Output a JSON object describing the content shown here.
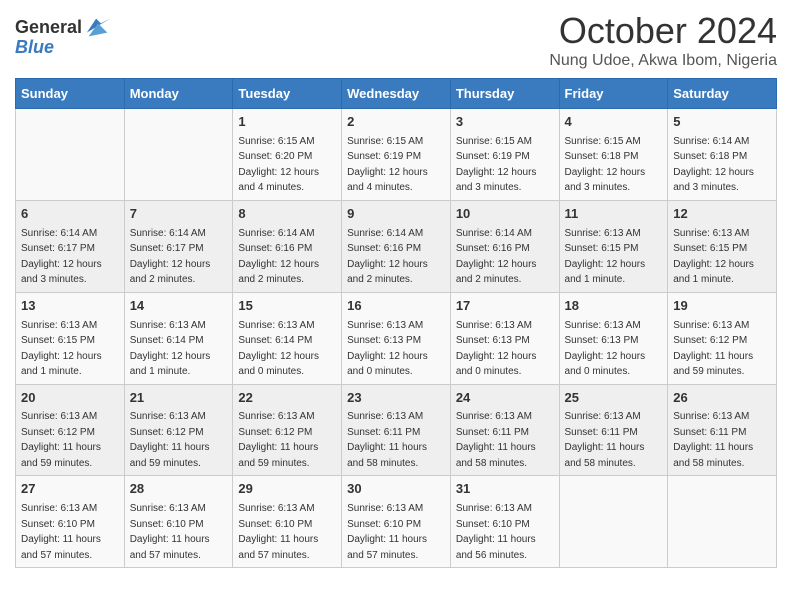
{
  "logo": {
    "line1": "General",
    "line2": "Blue"
  },
  "title": "October 2024",
  "location": "Nung Udoe, Akwa Ibom, Nigeria",
  "days_of_week": [
    "Sunday",
    "Monday",
    "Tuesday",
    "Wednesday",
    "Thursday",
    "Friday",
    "Saturday"
  ],
  "weeks": [
    [
      {
        "day": "",
        "sunrise": "",
        "sunset": "",
        "daylight": ""
      },
      {
        "day": "",
        "sunrise": "",
        "sunset": "",
        "daylight": ""
      },
      {
        "day": "1",
        "sunrise": "Sunrise: 6:15 AM",
        "sunset": "Sunset: 6:20 PM",
        "daylight": "Daylight: 12 hours and 4 minutes."
      },
      {
        "day": "2",
        "sunrise": "Sunrise: 6:15 AM",
        "sunset": "Sunset: 6:19 PM",
        "daylight": "Daylight: 12 hours and 4 minutes."
      },
      {
        "day": "3",
        "sunrise": "Sunrise: 6:15 AM",
        "sunset": "Sunset: 6:19 PM",
        "daylight": "Daylight: 12 hours and 3 minutes."
      },
      {
        "day": "4",
        "sunrise": "Sunrise: 6:15 AM",
        "sunset": "Sunset: 6:18 PM",
        "daylight": "Daylight: 12 hours and 3 minutes."
      },
      {
        "day": "5",
        "sunrise": "Sunrise: 6:14 AM",
        "sunset": "Sunset: 6:18 PM",
        "daylight": "Daylight: 12 hours and 3 minutes."
      }
    ],
    [
      {
        "day": "6",
        "sunrise": "Sunrise: 6:14 AM",
        "sunset": "Sunset: 6:17 PM",
        "daylight": "Daylight: 12 hours and 3 minutes."
      },
      {
        "day": "7",
        "sunrise": "Sunrise: 6:14 AM",
        "sunset": "Sunset: 6:17 PM",
        "daylight": "Daylight: 12 hours and 2 minutes."
      },
      {
        "day": "8",
        "sunrise": "Sunrise: 6:14 AM",
        "sunset": "Sunset: 6:16 PM",
        "daylight": "Daylight: 12 hours and 2 minutes."
      },
      {
        "day": "9",
        "sunrise": "Sunrise: 6:14 AM",
        "sunset": "Sunset: 6:16 PM",
        "daylight": "Daylight: 12 hours and 2 minutes."
      },
      {
        "day": "10",
        "sunrise": "Sunrise: 6:14 AM",
        "sunset": "Sunset: 6:16 PM",
        "daylight": "Daylight: 12 hours and 2 minutes."
      },
      {
        "day": "11",
        "sunrise": "Sunrise: 6:13 AM",
        "sunset": "Sunset: 6:15 PM",
        "daylight": "Daylight: 12 hours and 1 minute."
      },
      {
        "day": "12",
        "sunrise": "Sunrise: 6:13 AM",
        "sunset": "Sunset: 6:15 PM",
        "daylight": "Daylight: 12 hours and 1 minute."
      }
    ],
    [
      {
        "day": "13",
        "sunrise": "Sunrise: 6:13 AM",
        "sunset": "Sunset: 6:15 PM",
        "daylight": "Daylight: 12 hours and 1 minute."
      },
      {
        "day": "14",
        "sunrise": "Sunrise: 6:13 AM",
        "sunset": "Sunset: 6:14 PM",
        "daylight": "Daylight: 12 hours and 1 minute."
      },
      {
        "day": "15",
        "sunrise": "Sunrise: 6:13 AM",
        "sunset": "Sunset: 6:14 PM",
        "daylight": "Daylight: 12 hours and 0 minutes."
      },
      {
        "day": "16",
        "sunrise": "Sunrise: 6:13 AM",
        "sunset": "Sunset: 6:13 PM",
        "daylight": "Daylight: 12 hours and 0 minutes."
      },
      {
        "day": "17",
        "sunrise": "Sunrise: 6:13 AM",
        "sunset": "Sunset: 6:13 PM",
        "daylight": "Daylight: 12 hours and 0 minutes."
      },
      {
        "day": "18",
        "sunrise": "Sunrise: 6:13 AM",
        "sunset": "Sunset: 6:13 PM",
        "daylight": "Daylight: 12 hours and 0 minutes."
      },
      {
        "day": "19",
        "sunrise": "Sunrise: 6:13 AM",
        "sunset": "Sunset: 6:12 PM",
        "daylight": "Daylight: 11 hours and 59 minutes."
      }
    ],
    [
      {
        "day": "20",
        "sunrise": "Sunrise: 6:13 AM",
        "sunset": "Sunset: 6:12 PM",
        "daylight": "Daylight: 11 hours and 59 minutes."
      },
      {
        "day": "21",
        "sunrise": "Sunrise: 6:13 AM",
        "sunset": "Sunset: 6:12 PM",
        "daylight": "Daylight: 11 hours and 59 minutes."
      },
      {
        "day": "22",
        "sunrise": "Sunrise: 6:13 AM",
        "sunset": "Sunset: 6:12 PM",
        "daylight": "Daylight: 11 hours and 59 minutes."
      },
      {
        "day": "23",
        "sunrise": "Sunrise: 6:13 AM",
        "sunset": "Sunset: 6:11 PM",
        "daylight": "Daylight: 11 hours and 58 minutes."
      },
      {
        "day": "24",
        "sunrise": "Sunrise: 6:13 AM",
        "sunset": "Sunset: 6:11 PM",
        "daylight": "Daylight: 11 hours and 58 minutes."
      },
      {
        "day": "25",
        "sunrise": "Sunrise: 6:13 AM",
        "sunset": "Sunset: 6:11 PM",
        "daylight": "Daylight: 11 hours and 58 minutes."
      },
      {
        "day": "26",
        "sunrise": "Sunrise: 6:13 AM",
        "sunset": "Sunset: 6:11 PM",
        "daylight": "Daylight: 11 hours and 58 minutes."
      }
    ],
    [
      {
        "day": "27",
        "sunrise": "Sunrise: 6:13 AM",
        "sunset": "Sunset: 6:10 PM",
        "daylight": "Daylight: 11 hours and 57 minutes."
      },
      {
        "day": "28",
        "sunrise": "Sunrise: 6:13 AM",
        "sunset": "Sunset: 6:10 PM",
        "daylight": "Daylight: 11 hours and 57 minutes."
      },
      {
        "day": "29",
        "sunrise": "Sunrise: 6:13 AM",
        "sunset": "Sunset: 6:10 PM",
        "daylight": "Daylight: 11 hours and 57 minutes."
      },
      {
        "day": "30",
        "sunrise": "Sunrise: 6:13 AM",
        "sunset": "Sunset: 6:10 PM",
        "daylight": "Daylight: 11 hours and 57 minutes."
      },
      {
        "day": "31",
        "sunrise": "Sunrise: 6:13 AM",
        "sunset": "Sunset: 6:10 PM",
        "daylight": "Daylight: 11 hours and 56 minutes."
      },
      {
        "day": "",
        "sunrise": "",
        "sunset": "",
        "daylight": ""
      },
      {
        "day": "",
        "sunrise": "",
        "sunset": "",
        "daylight": ""
      }
    ]
  ]
}
